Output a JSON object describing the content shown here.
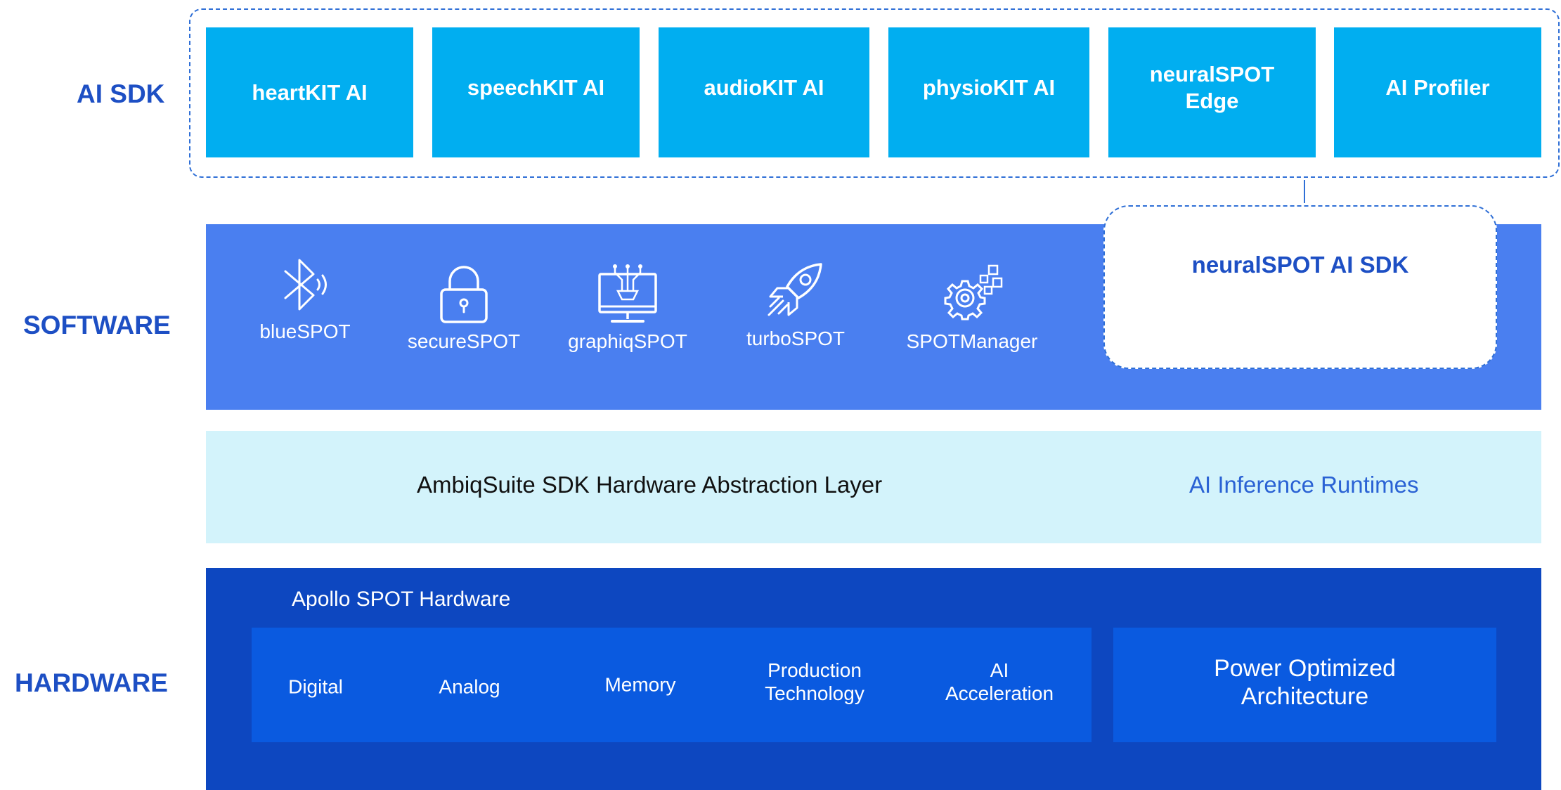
{
  "layers": {
    "ai_sdk": "AI SDK",
    "software": "SOFTWARE",
    "hardware": "HARDWARE"
  },
  "ai_sdk": {
    "items": [
      "heartKIT AI",
      "speechKIT AI",
      "audioKIT AI",
      "physioKIT AI",
      "neuralSPOT\nEdge",
      "AI Profiler"
    ]
  },
  "software": {
    "items": [
      {
        "label": "blueSPOT",
        "icon": "bluetooth-icon"
      },
      {
        "label": "secureSPOT",
        "icon": "lock-icon"
      },
      {
        "label": "graphiqSPOT",
        "icon": "monitor-circuit-icon"
      },
      {
        "label": "turboSPOT",
        "icon": "rocket-icon"
      },
      {
        "label": "SPOTManager",
        "icon": "gear-icon"
      }
    ],
    "neuralspot_sdk": "neuralSPOT AI SDK"
  },
  "hal": {
    "left": "AmbiqSuite SDK Hardware Abstraction Layer",
    "right": "AI Inference Runtimes"
  },
  "hardware": {
    "title": "Apollo SPOT Hardware",
    "items": [
      "Digital",
      "Analog",
      "Memory",
      "Production\nTechnology",
      "AI\nAcceleration"
    ],
    "power": "Power Optimized\nArchitecture"
  },
  "colors": {
    "ai_box": "#01aef0",
    "software_band": "#4a7ff0",
    "hal_band": "#d3f3fb",
    "hardware_band": "#0d47c0",
    "hardware_inner": "#0a5ae0",
    "label_blue": "#1d4fc4"
  }
}
